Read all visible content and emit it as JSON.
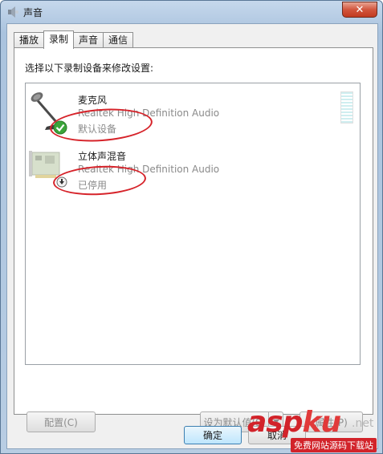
{
  "window": {
    "title": "声音",
    "close_icon": "close-icon"
  },
  "tabs": [
    {
      "label": "播放",
      "active": false
    },
    {
      "label": "录制",
      "active": true
    },
    {
      "label": "声音",
      "active": false
    },
    {
      "label": "通信",
      "active": false
    }
  ],
  "panel": {
    "instruction": "选择以下录制设备来修改设置:"
  },
  "devices": [
    {
      "name": "麦克风",
      "driver": "Realtek High Definition Audio",
      "status": "默认设备",
      "icon": "microphone-icon",
      "badge": "default-check-icon"
    },
    {
      "name": "立体声混音",
      "driver": "Realtek High Definition Audio",
      "status": "已停用",
      "icon": "sound-card-icon",
      "badge": "disabled-down-arrow-icon"
    }
  ],
  "buttons": {
    "configure": "配置(C)",
    "set_default": "设为默认值(S)",
    "properties": "属性(P)",
    "ok": "确定",
    "cancel": "取消"
  },
  "watermark": {
    "brand_asp": "asp",
    "brand_ku": "ku",
    "domain_suffix": ".net",
    "tagline": "免费网站源码下载站"
  },
  "colors": {
    "annotation_red": "#d6232a",
    "check_green": "#3aa53a"
  }
}
